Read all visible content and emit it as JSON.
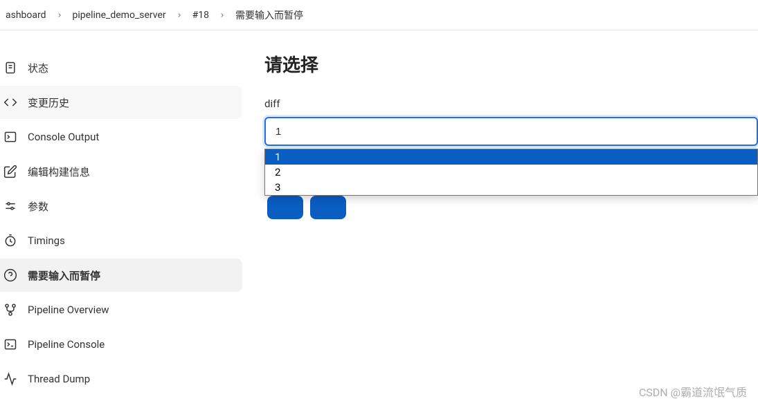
{
  "breadcrumb": {
    "items": [
      {
        "label": "ashboard"
      },
      {
        "label": "pipeline_demo_server"
      },
      {
        "label": "#18"
      },
      {
        "label": "需要输入而暂停"
      }
    ]
  },
  "sidebar": {
    "items": [
      {
        "label": "状态",
        "icon": "file-icon"
      },
      {
        "label": "变更历史",
        "icon": "code-icon"
      },
      {
        "label": "Console Output",
        "icon": "terminal-icon"
      },
      {
        "label": "编辑构建信息",
        "icon": "edit-icon"
      },
      {
        "label": "参数",
        "icon": "sliders-icon"
      },
      {
        "label": "Timings",
        "icon": "clock-icon"
      },
      {
        "label": "需要输入而暂停",
        "icon": "help-icon"
      },
      {
        "label": "Pipeline Overview",
        "icon": "branch-icon"
      },
      {
        "label": "Pipeline Console",
        "icon": "console-icon"
      },
      {
        "label": "Thread Dump",
        "icon": "activity-icon"
      }
    ]
  },
  "main": {
    "title": "请选择",
    "form": {
      "label": "diff",
      "selectedValue": "1",
      "options": [
        "1",
        "2",
        "3"
      ]
    }
  },
  "watermark": "CSDN @霸道流氓气质"
}
